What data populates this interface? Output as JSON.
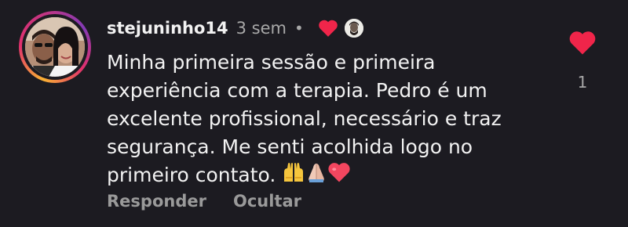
{
  "comment": {
    "username": "stejuninho14",
    "time": "3 sem",
    "separator": "•",
    "lines": [
      "Minha primeira sessão e primeira",
      "experiência com a terapia. Pedro é um",
      "excelente profissional, necessário e traz",
      "segurança. Me senti acolhida logo no",
      "primeiro contato."
    ],
    "emojis": [
      "raising-hands-icon",
      "folded-hands-icon",
      "heart-icon"
    ],
    "actions": {
      "reply": "Responder",
      "hide": "Ocultar"
    },
    "likes": {
      "count": "1"
    }
  },
  "colors": {
    "background": "#1c1b21",
    "heart": "#f0254a",
    "muted": "#a8a8a8"
  },
  "icons": {
    "small_heart": "heart-icon",
    "author_avatar": "author-avatar-icon",
    "like": "heart-icon"
  }
}
